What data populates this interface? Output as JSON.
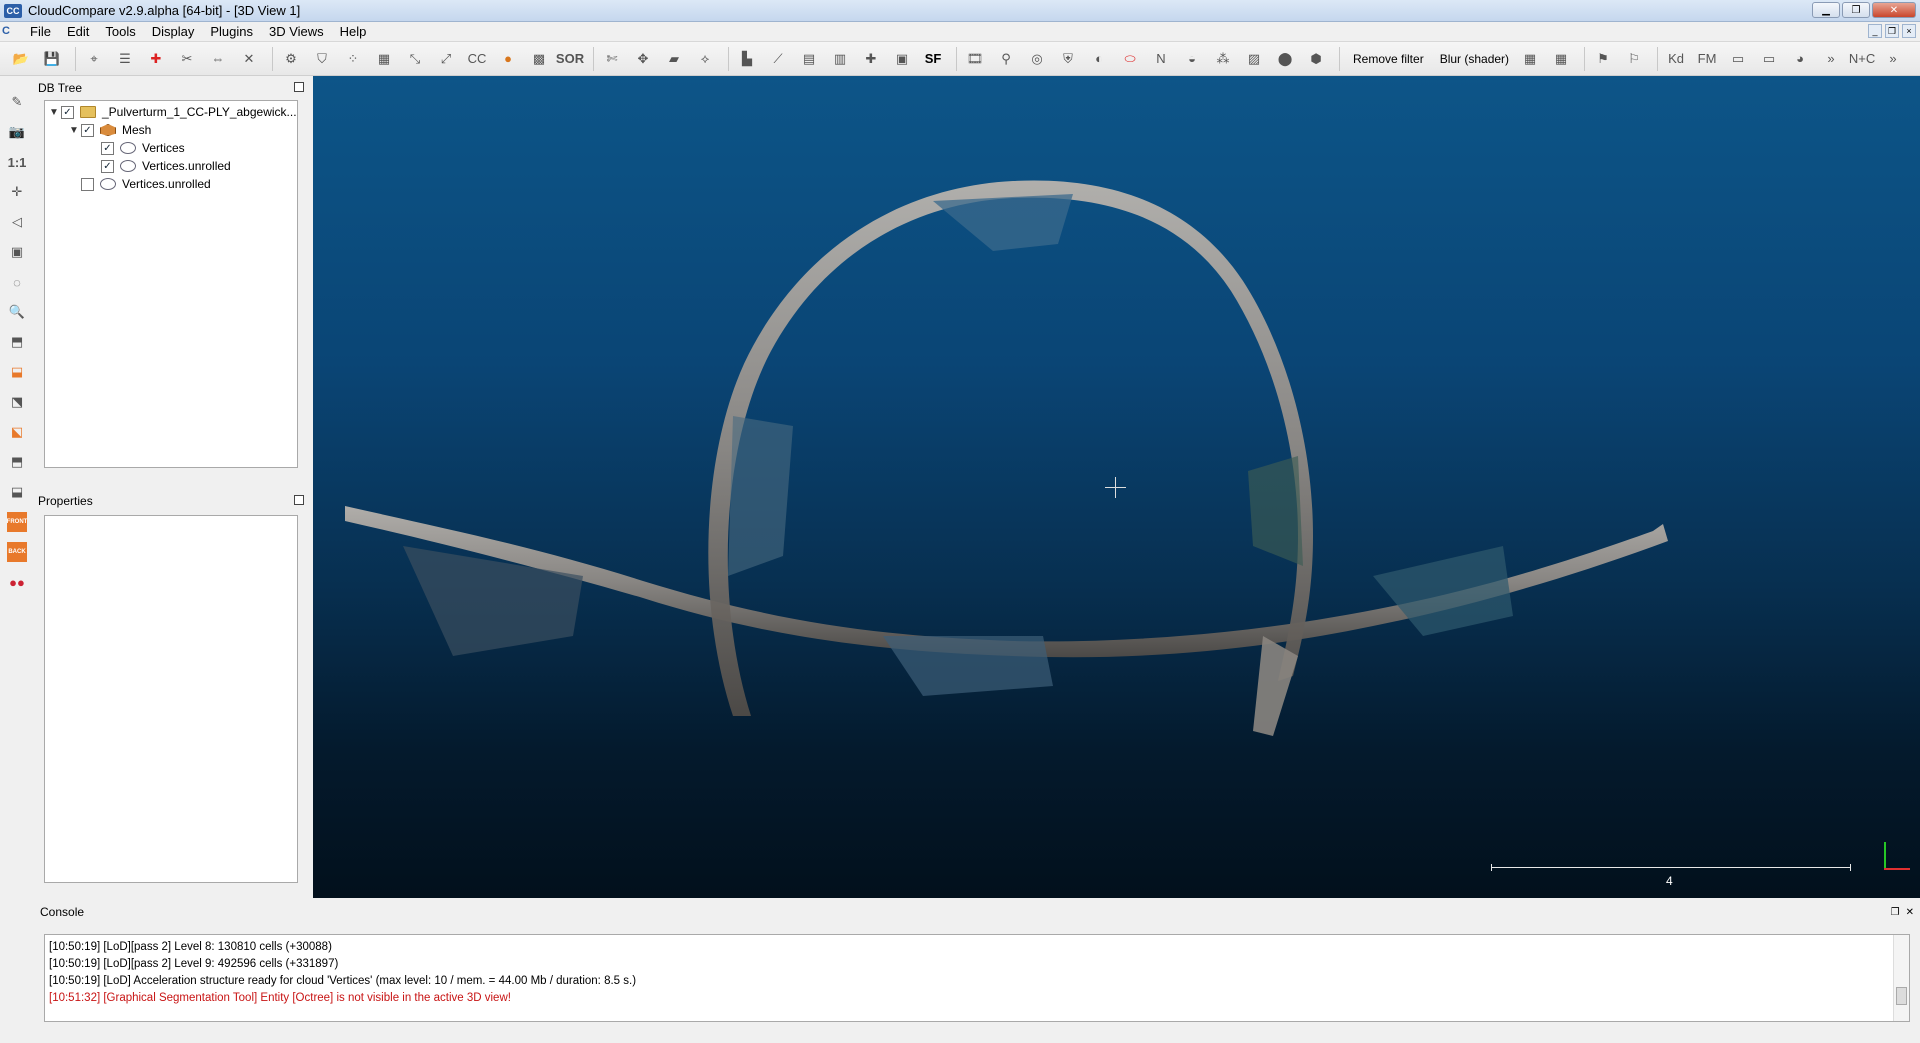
{
  "window": {
    "title": "CloudCompare v2.9.alpha [64-bit] - [3D View 1]",
    "logo": "CC"
  },
  "menu": [
    "File",
    "Edit",
    "Tools",
    "Display",
    "Plugins",
    "3D Views",
    "Help"
  ],
  "toolbar": {
    "sor_label": "SOR",
    "sf_label": "SF",
    "remove_filter_label": "Remove filter",
    "blur_label": "Blur (shader)"
  },
  "left_toolbar": {
    "zoom_label": "1:1",
    "front_label": "FRONT",
    "back_label": "BACK"
  },
  "db_tree": {
    "title": "DB Tree",
    "items": [
      {
        "label": "_Pulverturm_1_CC-PLY_abgewick...",
        "icon": "folder-icon",
        "checked": true,
        "level": 0
      },
      {
        "label": "Mesh",
        "icon": "mesh-icon",
        "checked": true,
        "level": 1
      },
      {
        "label": "Vertices",
        "icon": "cloud-icon",
        "checked": true,
        "level": 2
      },
      {
        "label": "Vertices.unrolled",
        "icon": "cloud-icon",
        "checked": true,
        "level": 2
      },
      {
        "label": "Vertices.unrolled",
        "icon": "cloud-icon",
        "checked": false,
        "level": 1
      }
    ]
  },
  "properties": {
    "title": "Properties"
  },
  "viewport": {
    "scale_value": "4",
    "background_top": "#0d5588",
    "background_bottom": "#02101c"
  },
  "console": {
    "title": "Console",
    "lines": [
      {
        "text": "[10:50:19] [LoD][pass 2] Level 8: 130810 cells (+30088)",
        "error": false
      },
      {
        "text": "[10:50:19] [LoD][pass 2] Level 9: 492596 cells (+331897)",
        "error": false
      },
      {
        "text": "[10:50:19] [LoD] Acceleration structure ready for cloud 'Vertices' (max level: 10 / mem. = 44.00 Mb / duration: 8.5 s.)",
        "error": false
      },
      {
        "text": "[10:51:32] [Graphical Segmentation Tool] Entity [Octree] is not visible in the active 3D view!",
        "error": true
      }
    ]
  }
}
